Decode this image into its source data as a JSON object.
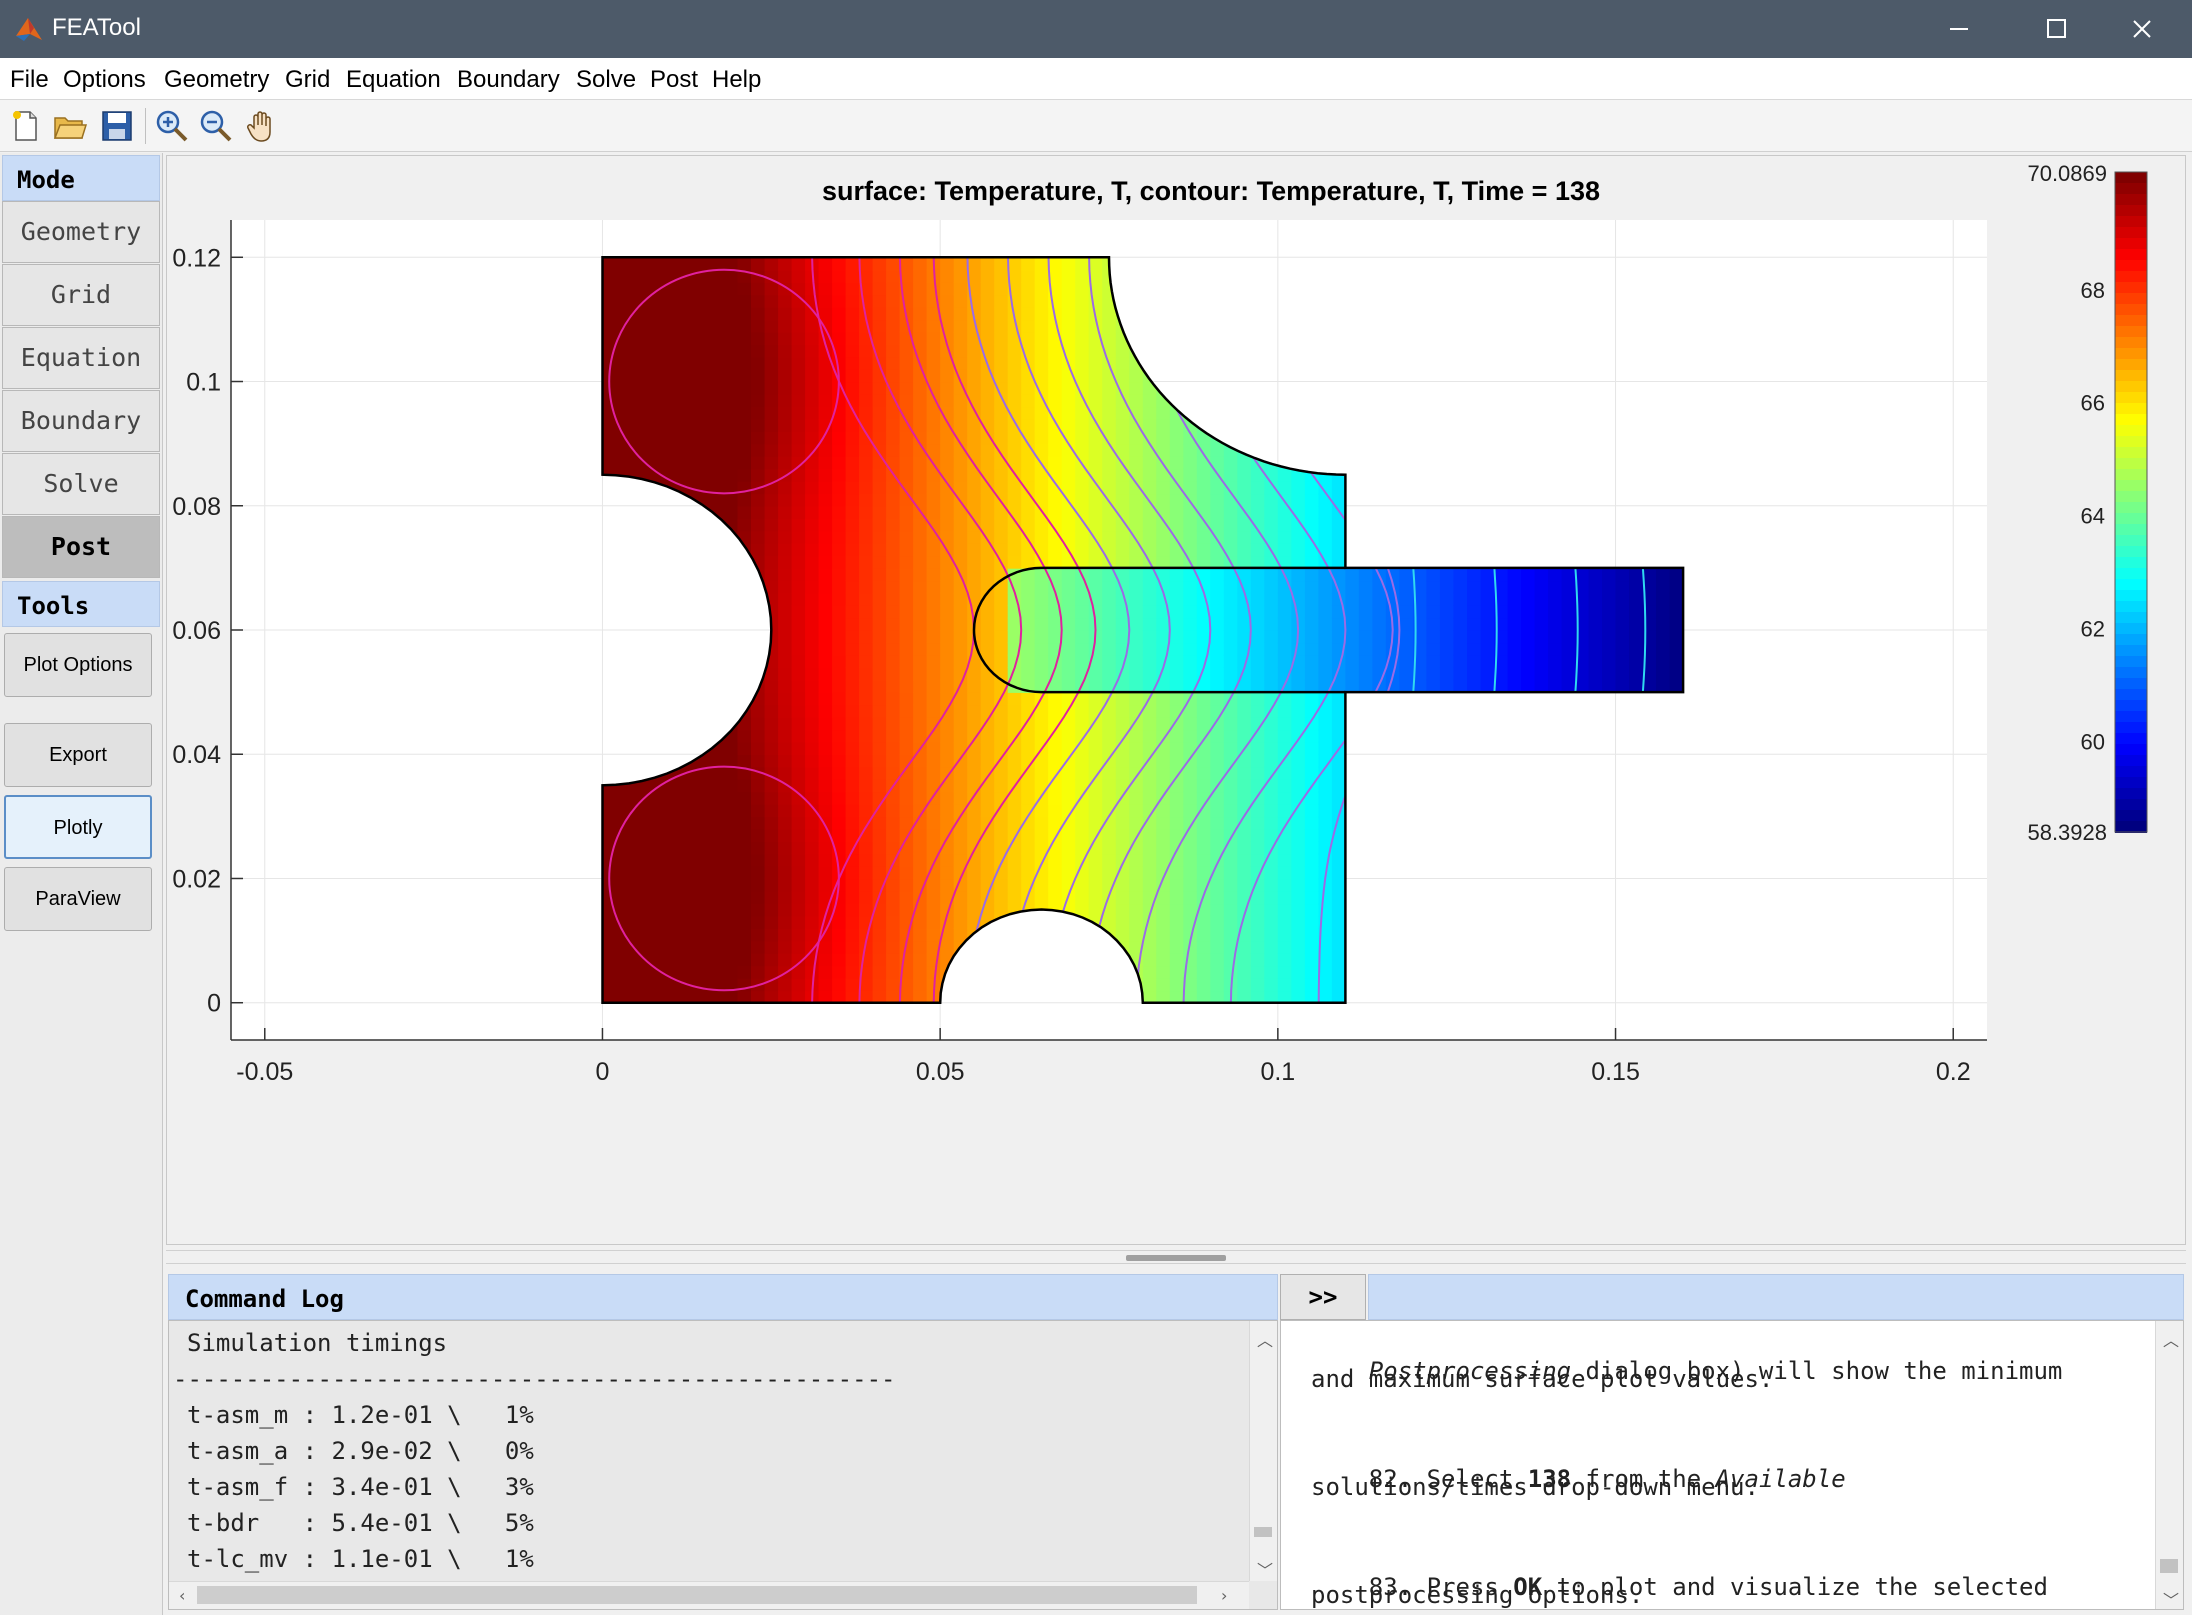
{
  "window": {
    "title": "FEATool",
    "buttons": {
      "minimize": "─",
      "maximize": "☐",
      "close": "✕"
    }
  },
  "menu": [
    "File",
    "Options",
    "Geometry",
    "Grid",
    "Equation",
    "Boundary",
    "Solve",
    "Post",
    "Help"
  ],
  "toolbar": {
    "icons": [
      "new-file-icon",
      "open-folder-icon",
      "save-icon",
      "zoom-in-icon",
      "zoom-out-icon",
      "pan-hand-icon"
    ]
  },
  "sidebar": {
    "mode_header": "Mode",
    "modes": [
      "Geometry",
      "Grid",
      "Equation",
      "Boundary",
      "Solve",
      "Post"
    ],
    "active_mode": "Post",
    "tools_header": "Tools",
    "tools": [
      "Plot Options",
      "Export",
      "Plotly",
      "ParaView"
    ]
  },
  "plot": {
    "title": "surface: Temperature, T, contour: Temperature, T, Time = 138",
    "xticks": [
      "-0.05",
      "0",
      "0.05",
      "0.1",
      "0.15",
      "0.2"
    ],
    "yticks": [
      "0",
      "0.02",
      "0.04",
      "0.06",
      "0.08",
      "0.1",
      "0.12"
    ],
    "xlim": [
      -0.055,
      0.205
    ],
    "ylim": [
      -0.006,
      0.126
    ],
    "colorbar": {
      "max_label": "70.0869",
      "min_label": "58.3928",
      "min": 58.3928,
      "max": 70.0869,
      "ticks": [
        "68",
        "66",
        "64",
        "62",
        "60"
      ],
      "colormap": "jet"
    },
    "colors": {
      "axes_bg": "#ffffff",
      "grid": "#e6e6e6",
      "boundary": "#000000"
    }
  },
  "command_log": {
    "header": "Command Log",
    "toggle": ">>",
    "lines": [
      "Simulation timings",
      "--------------------------------------------------",
      "t-asm_m : 1.2e-01 \\   1%",
      "t-asm_a : 2.9e-02 \\   0%",
      "t-asm_f : 3.4e-01 \\   3%",
      "t-bdr   : 5.4e-01 \\   5%",
      "t-lc_mv : 1.1e-01 \\   1%"
    ]
  },
  "help": {
    "lines": [
      "Postprocessing dialog box) will show the minimum",
      "and maximum surface plot values.",
      "",
      "82. Select 138 from the Available",
      "solutions/times drop-down menu.",
      "",
      "83. Press OK to plot and visualize the selected",
      "postprocessing options."
    ]
  }
}
